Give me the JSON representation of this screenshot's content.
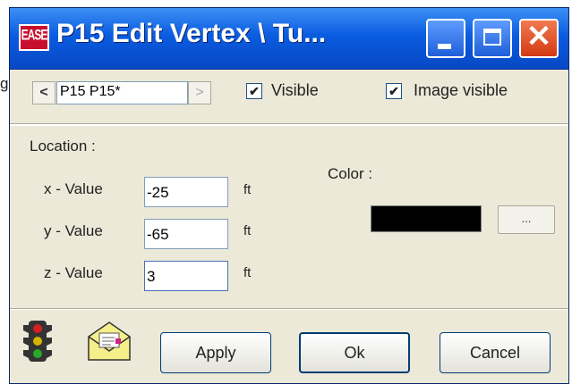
{
  "background_fragment": "g",
  "window": {
    "app_icon_text": "EASE",
    "title": "P15 Edit Vertex \\ Tu...",
    "close_glyph": "✕"
  },
  "vertex_nav": {
    "prev": "<",
    "next": ">",
    "current": "P15 P15*"
  },
  "visible": {
    "label": "Visible",
    "checked": true,
    "mark": "✔"
  },
  "image_visible": {
    "label": "Image visible",
    "checked": true,
    "mark": "✔"
  },
  "location": {
    "label": "Location :",
    "x": {
      "label": "x - Value",
      "value": "-25",
      "unit": "ft"
    },
    "y": {
      "label": "y - Value",
      "value": "-65",
      "unit": "ft"
    },
    "z": {
      "label": "z - Value",
      "value": "3",
      "unit": "ft"
    }
  },
  "color": {
    "label": "Color :",
    "value": "#000000",
    "button": "..."
  },
  "icons": {
    "left": "traffic-light-icon",
    "right": "mail-envelope-icon"
  },
  "buttons": {
    "apply": "Apply",
    "ok": "Ok",
    "cancel": "Cancel"
  }
}
